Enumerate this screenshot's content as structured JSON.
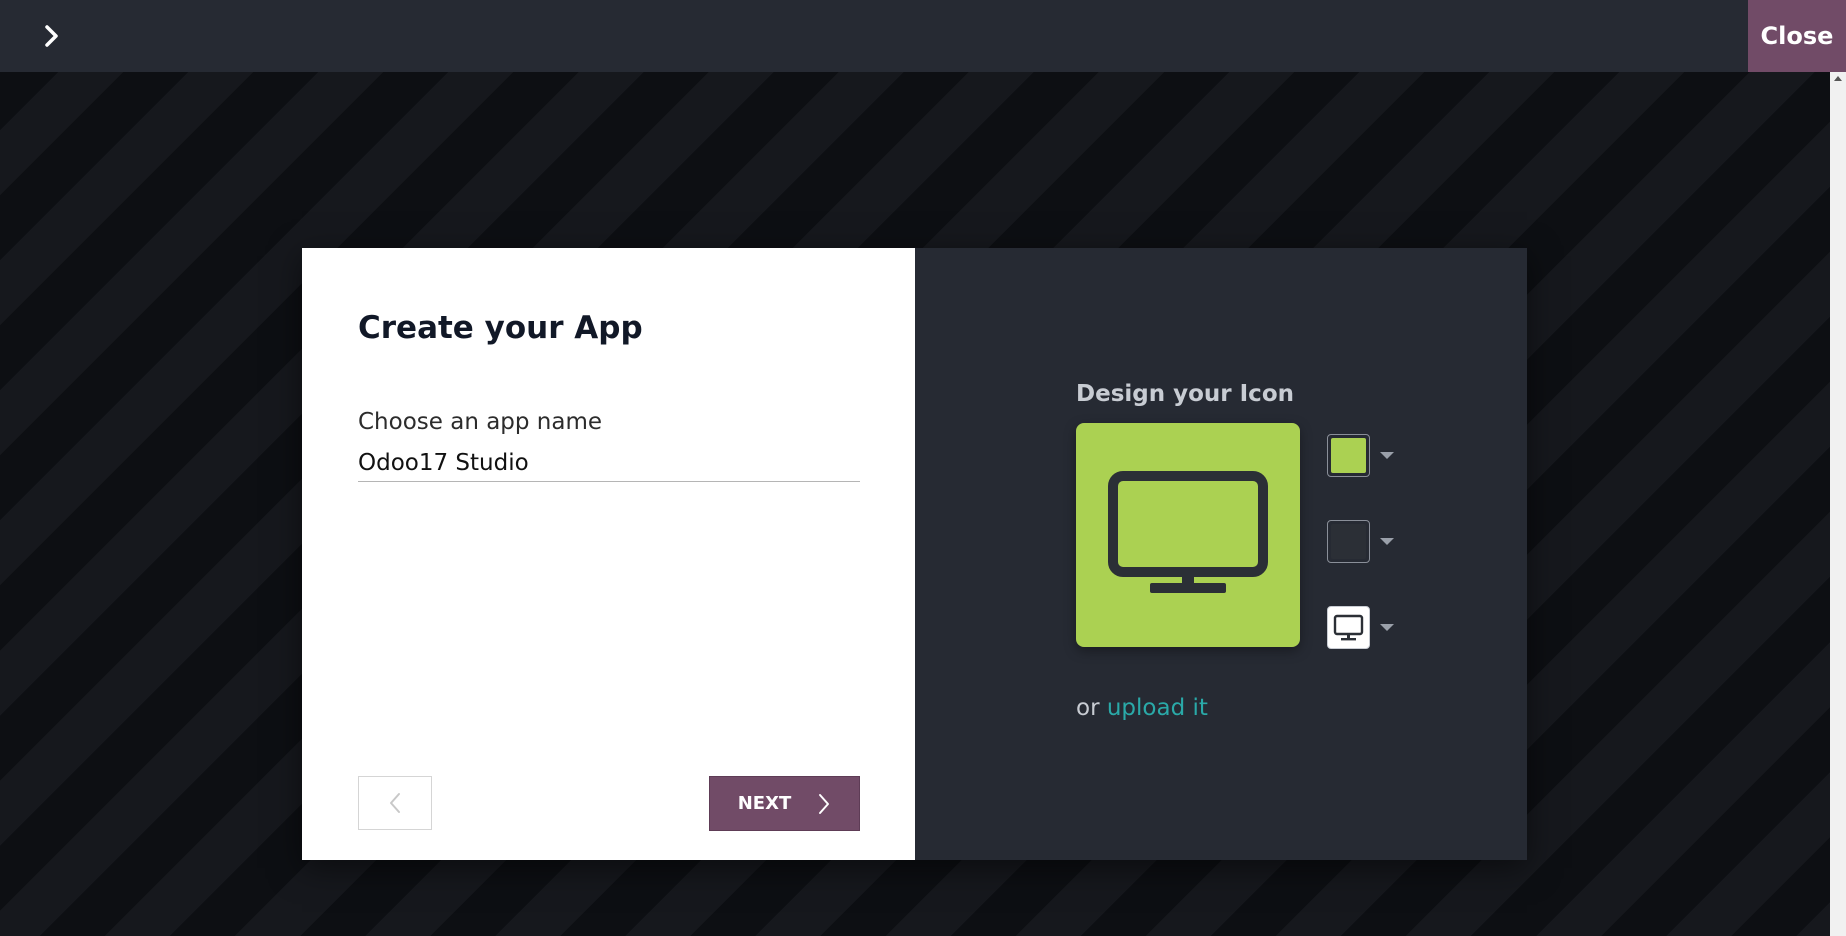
{
  "topbar": {
    "toggle_icon": "chevron-right-icon",
    "close_label": "Close",
    "close_color": "#714b67"
  },
  "dialog": {
    "title": "Create your App",
    "app_name_label": "Choose an app name",
    "app_name_value": "Odoo17 Studio",
    "next_label": "NEXT",
    "previous_icon": "chevron-left-icon",
    "next_icon": "chevron-right-icon"
  },
  "icon_designer": {
    "title": "Design your Icon",
    "background_color": "#abd152",
    "icon_color": "#2b2f36",
    "icon_name": "desktop-icon",
    "upload_prefix": "or",
    "upload_link": "upload it"
  }
}
